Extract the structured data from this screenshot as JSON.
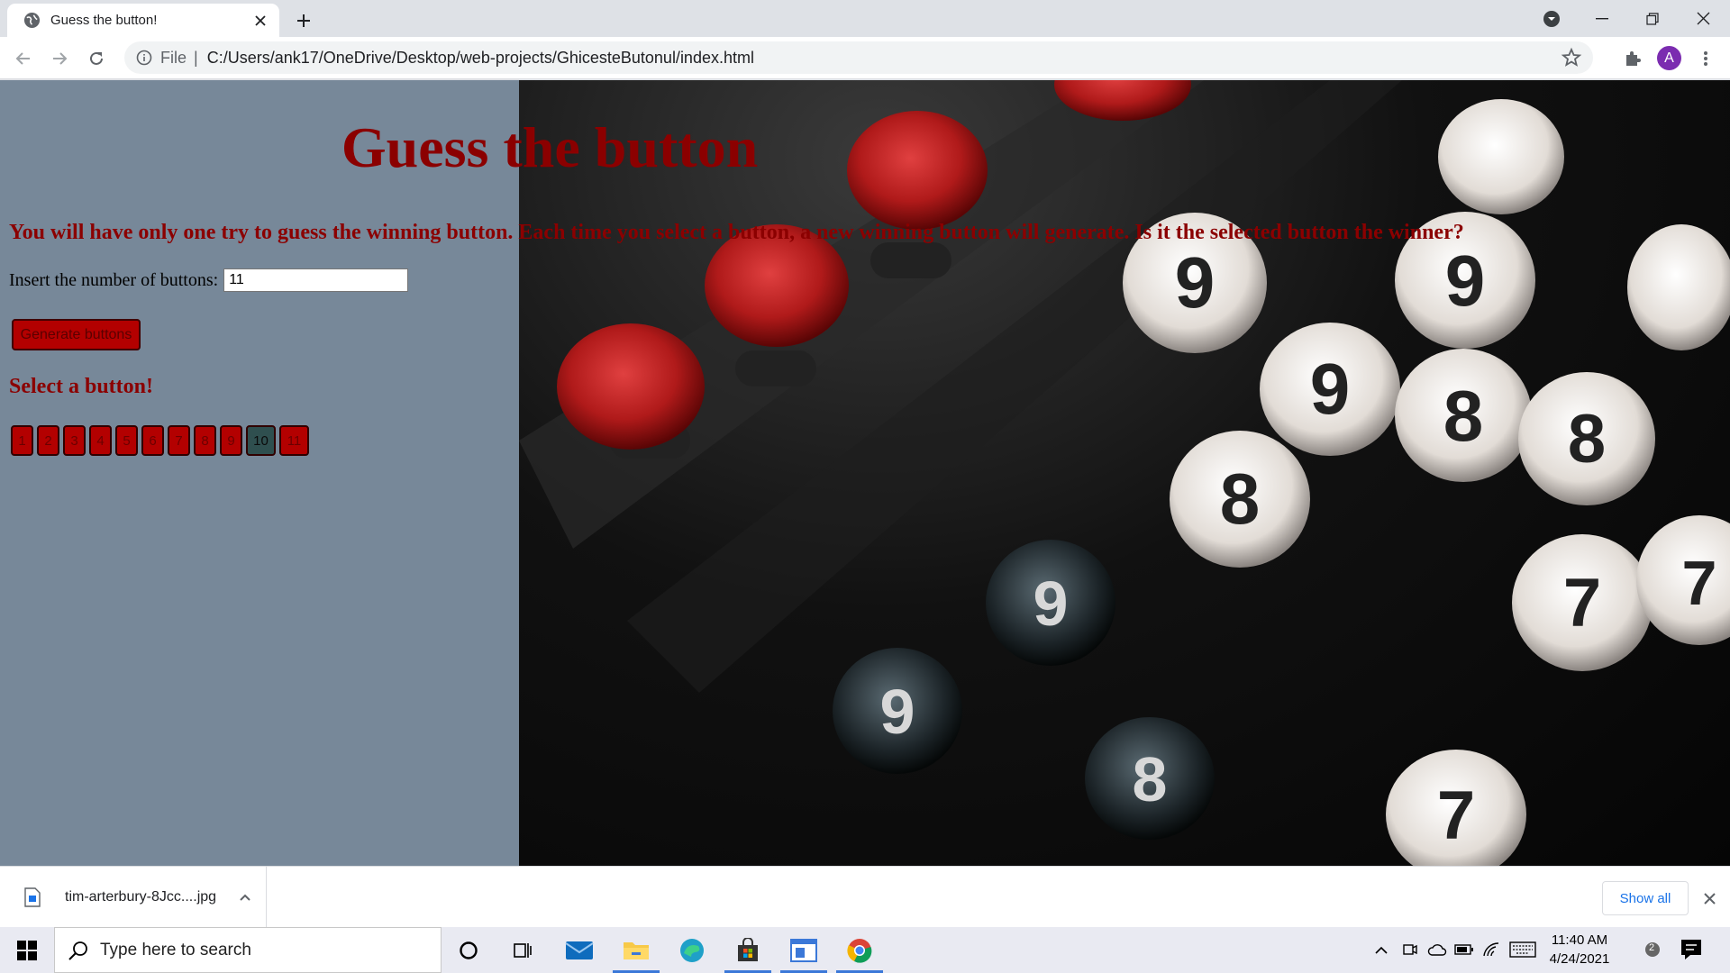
{
  "browser": {
    "tab_title": "Guess the button!",
    "url_scheme": "File",
    "url_separator": "|",
    "url": "C:/Users/ank17/OneDrive/Desktop/web-projects/GhicesteButonul/index.html",
    "profile_initial": "A"
  },
  "page": {
    "heading": "Guess the button",
    "instructions": "You will have only one try to guess the winning button. Each time you select a button, a new winning button will generate. Is it the selected button the winner?",
    "count_label": "Insert the number of buttons:",
    "count_value": "11",
    "generate_label": "Generate buttons",
    "select_title": "Select a button!",
    "number_buttons": [
      "1",
      "2",
      "3",
      "4",
      "5",
      "6",
      "7",
      "8",
      "9",
      "10",
      "11"
    ],
    "selected_button": "10",
    "colors": {
      "page_bg": "#778899",
      "heading": "#8b0000",
      "button_bg": "#b30000",
      "selected_bg": "#2f4f4f"
    }
  },
  "downloads": {
    "file_name": "tim-arterbury-8Jcc....jpg",
    "show_all": "Show all"
  },
  "taskbar": {
    "search_placeholder": "Type here to search",
    "time": "11:40 AM",
    "date": "4/24/2021",
    "notification_count": "2"
  }
}
